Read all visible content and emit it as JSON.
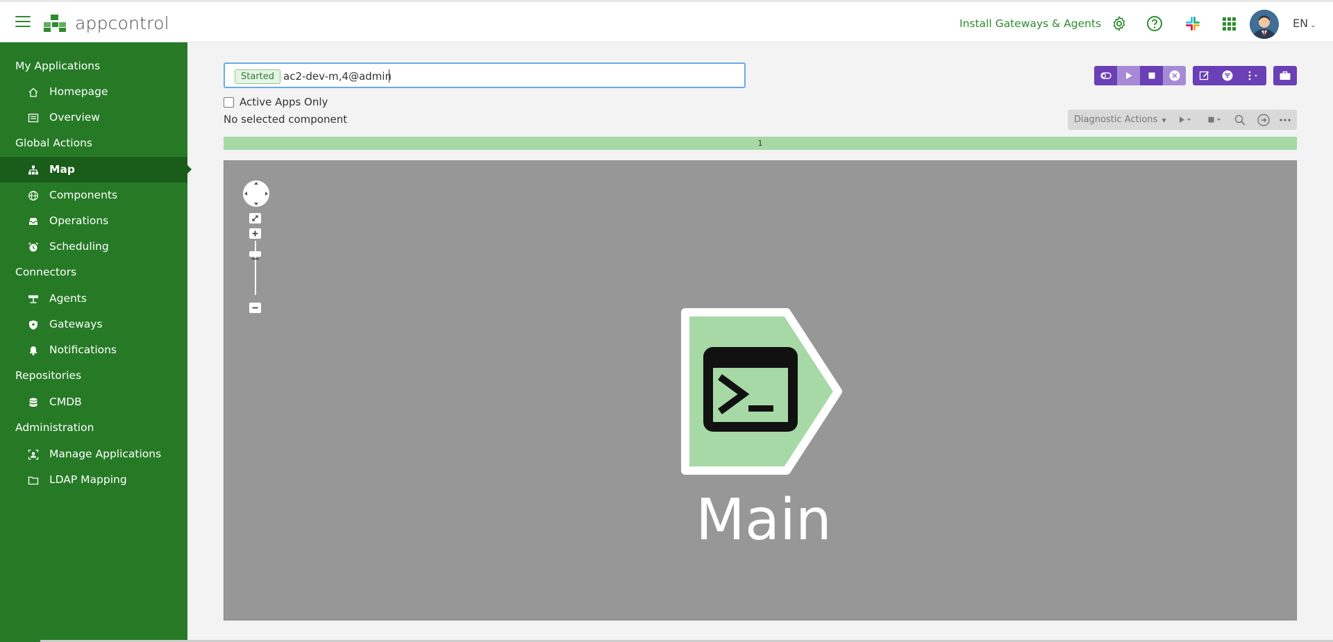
{
  "header": {
    "brand": "appcontrol",
    "install_link": "Install Gateways & Agents",
    "language": "EN"
  },
  "sidebar": {
    "sections": [
      {
        "label": "My Applications",
        "items": [
          {
            "label": "Homepage",
            "icon": "home-icon"
          },
          {
            "label": "Overview",
            "icon": "overview-icon"
          }
        ]
      },
      {
        "label": "Global Actions",
        "items": [
          {
            "label": "Map",
            "icon": "sitemap-icon",
            "active": true
          },
          {
            "label": "Components",
            "icon": "globe-icon"
          },
          {
            "label": "Operations",
            "icon": "inbox-icon"
          },
          {
            "label": "Scheduling",
            "icon": "alarm-clock-icon"
          }
        ]
      },
      {
        "label": "Connectors",
        "items": [
          {
            "label": "Agents",
            "icon": "agent-icon"
          },
          {
            "label": "Gateways",
            "icon": "shield-icon"
          },
          {
            "label": "Notifications",
            "icon": "bell-icon"
          }
        ]
      },
      {
        "label": "Repositories",
        "items": [
          {
            "label": "CMDB",
            "icon": "database-icon"
          }
        ]
      },
      {
        "label": "Administration",
        "items": [
          {
            "label": "Manage Applications",
            "icon": "user-frame-icon"
          },
          {
            "label": "LDAP Mapping",
            "icon": "folder-icon"
          }
        ]
      }
    ]
  },
  "app_selector": {
    "status": "Started",
    "value": "ac2-dev-m,4@admin"
  },
  "filters": {
    "active_apps_only": "Active Apps Only",
    "active_apps_checked": false,
    "selection_text": "No selected component"
  },
  "diagnostic": {
    "actions_label": "Diagnostic Actions"
  },
  "progress": {
    "label": "1",
    "percent": 100
  },
  "map": {
    "node_label": "Main",
    "node_icon": "terminal-icon",
    "node_color": "#a6d9a6"
  },
  "colors": {
    "sidebar": "#267a26",
    "accent": "#2e8b2e",
    "toolbar": "#6b3fb5"
  }
}
